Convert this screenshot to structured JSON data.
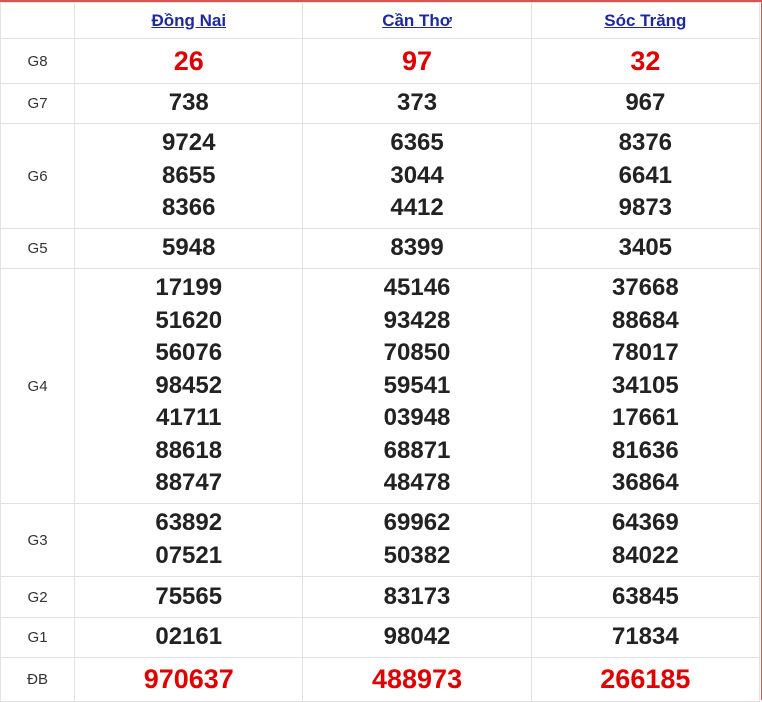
{
  "provinces": [
    "Đồng Nai",
    "Cần Thơ",
    "Sóc Trăng"
  ],
  "prizes": [
    {
      "label": "G8",
      "values": [
        [
          "26"
        ],
        [
          "97"
        ],
        [
          "32"
        ]
      ],
      "style": "red"
    },
    {
      "label": "G7",
      "values": [
        [
          "738"
        ],
        [
          "373"
        ],
        [
          "967"
        ]
      ]
    },
    {
      "label": "G6",
      "values": [
        [
          "9724",
          "8655",
          "8366"
        ],
        [
          "6365",
          "3044",
          "4412"
        ],
        [
          "8376",
          "6641",
          "9873"
        ]
      ]
    },
    {
      "label": "G5",
      "values": [
        [
          "5948"
        ],
        [
          "8399"
        ],
        [
          "3405"
        ]
      ]
    },
    {
      "label": "G4",
      "values": [
        [
          "17199",
          "51620",
          "56076",
          "98452",
          "41711",
          "88618",
          "88747"
        ],
        [
          "45146",
          "93428",
          "70850",
          "59541",
          "03948",
          "68871",
          "48478"
        ],
        [
          "37668",
          "88684",
          "78017",
          "34105",
          "17661",
          "81636",
          "36864"
        ]
      ]
    },
    {
      "label": "G3",
      "values": [
        [
          "63892",
          "07521"
        ],
        [
          "69962",
          "50382"
        ],
        [
          "64369",
          "84022"
        ]
      ]
    },
    {
      "label": "G2",
      "values": [
        [
          "75565"
        ],
        [
          "83173"
        ],
        [
          "63845"
        ]
      ]
    },
    {
      "label": "G1",
      "values": [
        [
          "02161"
        ],
        [
          "98042"
        ],
        [
          "71834"
        ]
      ]
    },
    {
      "label": "ĐB",
      "values": [
        [
          "970637"
        ],
        [
          "488973"
        ],
        [
          "266185"
        ]
      ],
      "style": "red"
    }
  ],
  "colors": {
    "accent": "#d9534f",
    "number_red": "#e00000",
    "link": "#1e2a9c"
  }
}
